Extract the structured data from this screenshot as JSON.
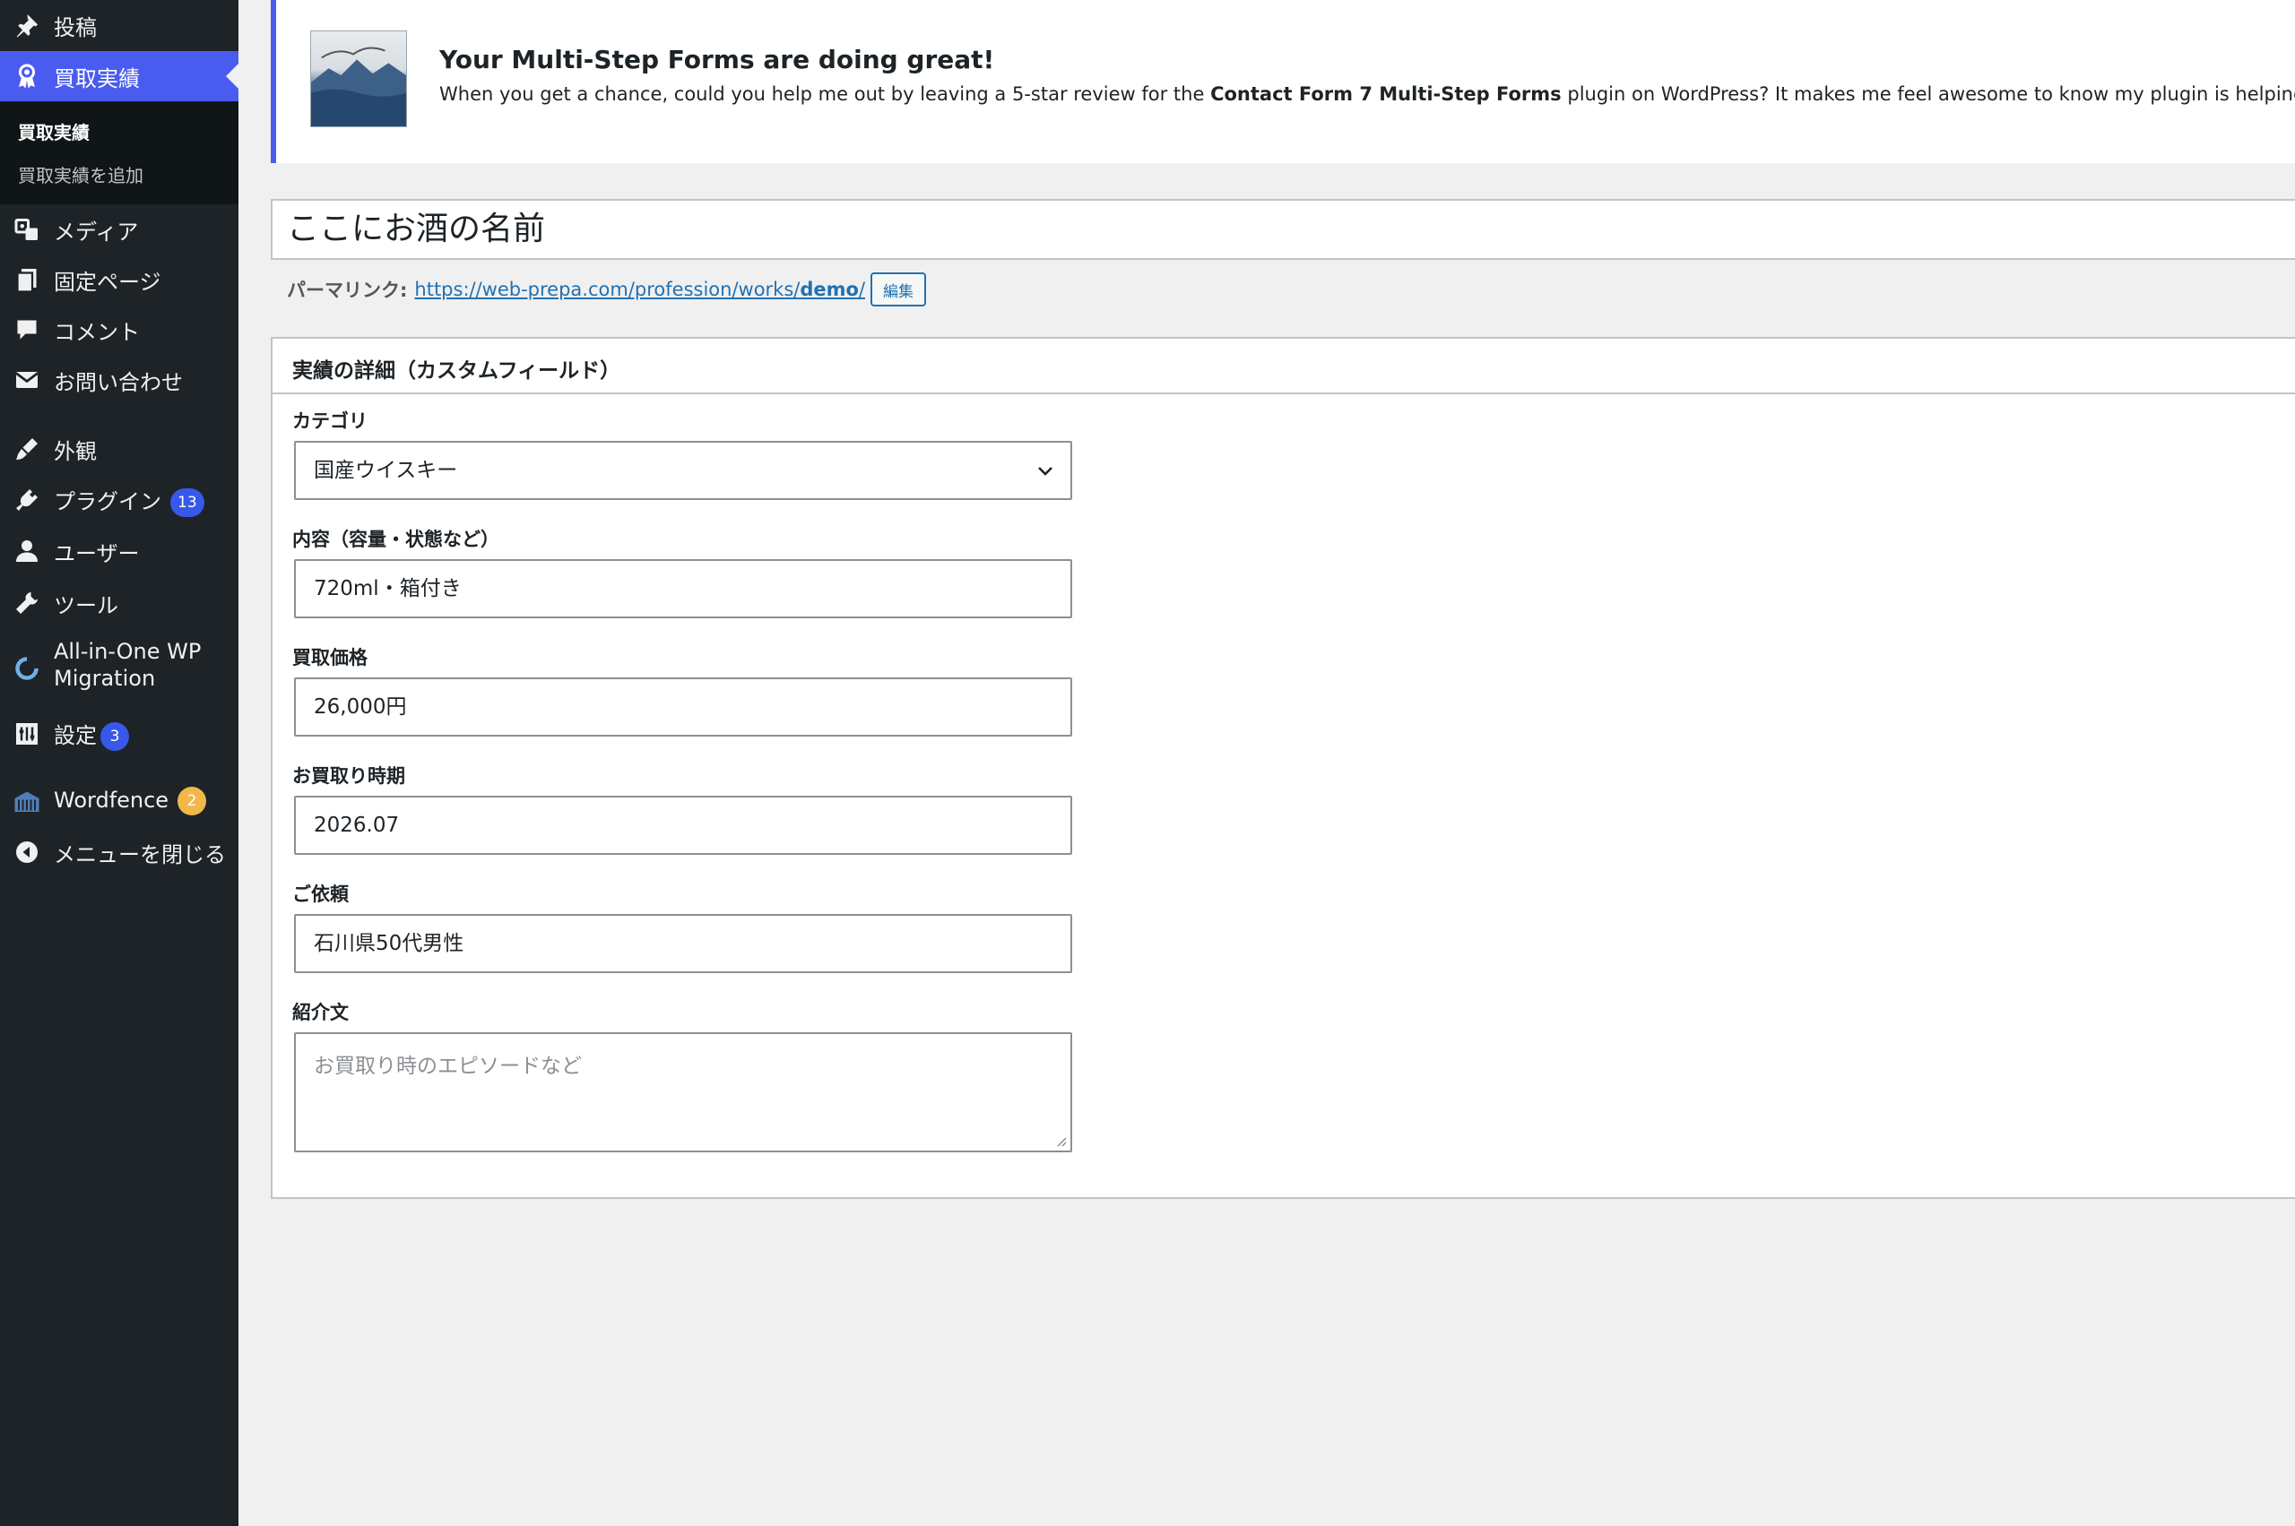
{
  "sidebar": {
    "items": [
      {
        "label": "投稿",
        "icon": "pin-icon"
      },
      {
        "label": "買取実績",
        "icon": "award-icon",
        "current": true
      },
      {
        "label": "メディア",
        "icon": "media-icon"
      },
      {
        "label": "固定ページ",
        "icon": "pages-icon"
      },
      {
        "label": "コメント",
        "icon": "comment-icon"
      },
      {
        "label": "お問い合わせ",
        "icon": "mail-icon"
      },
      {
        "label": "外観",
        "icon": "brush-icon"
      },
      {
        "label": "プラグイン",
        "icon": "plugin-icon",
        "badge": "13"
      },
      {
        "label": "ユーザー",
        "icon": "user-icon"
      },
      {
        "label": "ツール",
        "icon": "wrench-icon"
      },
      {
        "label": "All-in-One WP",
        "label2": "Migration",
        "icon": "migration-icon"
      },
      {
        "label": "設定",
        "icon": "settings-icon",
        "badge": "3"
      },
      {
        "label": "Wordfence",
        "icon": "wordfence-icon",
        "badge": "2"
      },
      {
        "label": "メニューを閉じる",
        "icon": "collapse-icon"
      }
    ],
    "submenu": [
      {
        "label": "買取実績",
        "active": true
      },
      {
        "label": "買取実績を追加"
      }
    ]
  },
  "notice": {
    "title": "Your Multi-Step Forms are doing great!",
    "text_before": "When you get a chance, could you help me out by leaving a 5-star review for the ",
    "text_bold": "Contact Form 7 Multi-Step Forms",
    "text_after": " plugin on WordPress? It makes me feel awesome to know my plugin is helping others."
  },
  "post": {
    "title": "ここにお酒の名前",
    "permalink_label": "パーマリンク:",
    "permalink_base": "https://web-prepa.com/profession/works/",
    "permalink_slug": "demo",
    "permalink_trailing": "/",
    "edit_label": "編集"
  },
  "metabox": {
    "title": "実績の詳細（カスタムフィールド）",
    "fields": {
      "category": {
        "label": "カテゴリ",
        "value": "国産ウイスキー"
      },
      "content": {
        "label": "内容（容量・状態など）",
        "value": "720ml・箱付き"
      },
      "price": {
        "label": "買取価格",
        "value": "26,000円"
      },
      "date": {
        "label": "お買取り時期",
        "value": "2026.07"
      },
      "client": {
        "label": "ご依頼",
        "value": "石川県50代男性"
      },
      "intro": {
        "label": "紹介文",
        "value": "",
        "placeholder": "お買取り時のエピソードなど"
      }
    }
  },
  "colors": {
    "sidebar_bg": "#1d2327",
    "accent": "#4a5cf0",
    "badge_blue": "#3858e9",
    "badge_orange": "#f0b849",
    "link": "#2271b1"
  }
}
